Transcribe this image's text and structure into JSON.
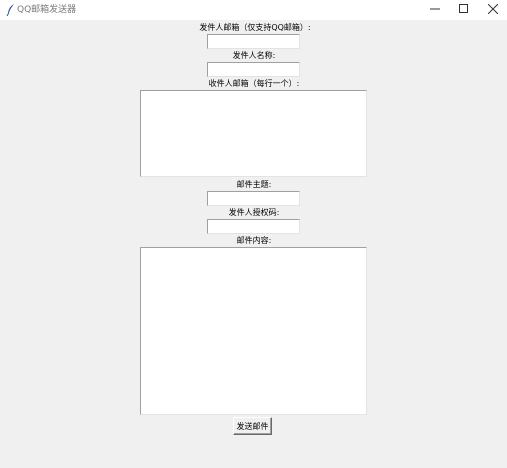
{
  "window": {
    "title": "QQ邮箱发送器",
    "icon": "feather-icon",
    "controls": {
      "minimize": "minimize-icon",
      "maximize": "maximize-icon",
      "close": "close-icon"
    }
  },
  "form": {
    "sender_email_label": "发件人邮箱（仅支持QQ邮箱）:",
    "sender_email_value": "",
    "sender_name_label": "发件人名称:",
    "sender_name_value": "",
    "recipients_label": "收件人邮箱（每行一个）:",
    "recipients_value": "",
    "subject_label": "邮件主题:",
    "subject_value": "",
    "auth_code_label": "发件人授权码:",
    "auth_code_value": "",
    "content_label": "邮件内容:",
    "content_value": "",
    "send_button_label": "发送邮件"
  }
}
